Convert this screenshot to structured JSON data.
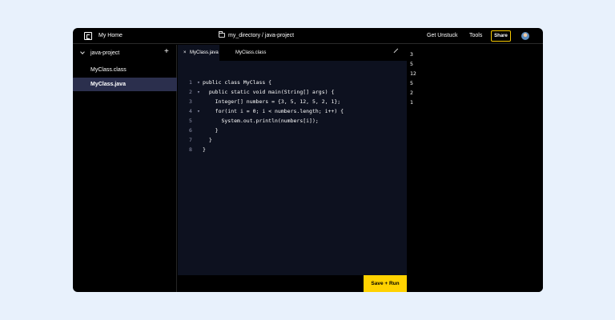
{
  "topbar": {
    "home": "My Home",
    "path": "my_directory / java-project",
    "get_unstuck": "Get Unstuck",
    "tools": "Tools",
    "share": "Share"
  },
  "sidebar": {
    "project": "java-project",
    "files": [
      "MyClass.class",
      "MyClass.java"
    ]
  },
  "tabs": [
    {
      "label": "MyClass.java",
      "active": true
    },
    {
      "label": "MyClass.class",
      "active": false
    }
  ],
  "editor": {
    "code_lines": [
      "public class MyClass {",
      "  public static void main(String[] args) {",
      "    Integer[] numbers = {3, 5, 12, 5, 2, 1};",
      "    for(int i = 0; i < numbers.length; i++) {",
      "      System.out.println(numbers[i]);",
      "    }",
      "  }",
      "}"
    ],
    "line_numbers": [
      "1",
      "2",
      "3",
      "4",
      "5",
      "6",
      "7",
      "8"
    ],
    "run_button": "Save + Run"
  },
  "output": {
    "lines": [
      "3",
      "5",
      "12",
      "5",
      "2",
      "1"
    ]
  },
  "colors": {
    "background": "#e8f1fc",
    "window": "#000000",
    "editor": "#0d111f",
    "accent": "#ffd200",
    "selected_file": "#2b2f4d"
  },
  "icons": [
    "ide-logo-icon",
    "folder-icon",
    "avatar-icon",
    "chevron-down-icon",
    "plus-icon",
    "close-icon",
    "expand-icon",
    "fold-arrow-icon"
  ]
}
